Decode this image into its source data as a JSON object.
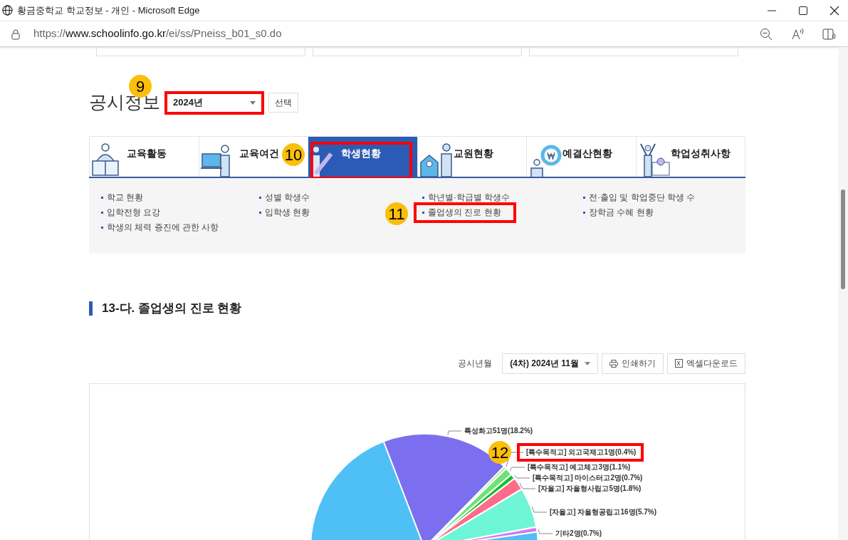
{
  "window": {
    "title": "황금중학교 학교정보 - 개인 - Microsoft Edge"
  },
  "address_bar": {
    "url_prefix": "https://",
    "url_domain": "www.schoolinfo.go.kr",
    "url_path": "/ei/ss/Pneiss_b01_s0.do"
  },
  "disclosure": {
    "title": "공시정보",
    "year": "2024년",
    "select_button": "선택"
  },
  "tabs": [
    {
      "label": "교육활동",
      "selected": false
    },
    {
      "label": "교육여건",
      "selected": false
    },
    {
      "label": "학생현황",
      "selected": true
    },
    {
      "label": "교원현황",
      "selected": false
    },
    {
      "label": "예결산현황",
      "selected": false
    },
    {
      "label": "학업성취사항",
      "selected": false
    }
  ],
  "submenu_columns": [
    [
      "학교 현황",
      "입학전형 요강",
      "학생의 체력 증진에 관한 사항"
    ],
    [
      "성별 학생수",
      "입학생 현황"
    ],
    [
      "학년별·학급별 학생수",
      "졸업생의 진로 현황"
    ],
    [
      "전·출입 및 학업중단 학생 수",
      "장학금 수혜 현황"
    ]
  ],
  "section": {
    "title": "13-다. 졸업생의 진로 현황",
    "period_label": "공시년월",
    "period": "(4차) 2024년 11월",
    "print_button": "인쇄하기",
    "excel_button": "엑셀다운로드",
    "chart_data": {
      "type": "pie",
      "categories": [
        "특성화고51명(18.2%)",
        "[특수목적고] 외고국제고1명(0.4%)",
        "[특수목적고] 예고체고3명(1.1%)",
        "[특수목적고] 마이스터고2명(0.7%)",
        "[자율고] 자율형사립고5명(1.8%)",
        "[자율고] 자율형공립고16명(5.7%)",
        "기타2명(0.7%)"
      ],
      "values": [
        18.2,
        0.4,
        1.1,
        0.7,
        1.8,
        5.7,
        0.7
      ]
    }
  },
  "annotations": [
    {
      "number": "9"
    },
    {
      "number": "10"
    },
    {
      "number": "11"
    },
    {
      "number": "12"
    }
  ]
}
